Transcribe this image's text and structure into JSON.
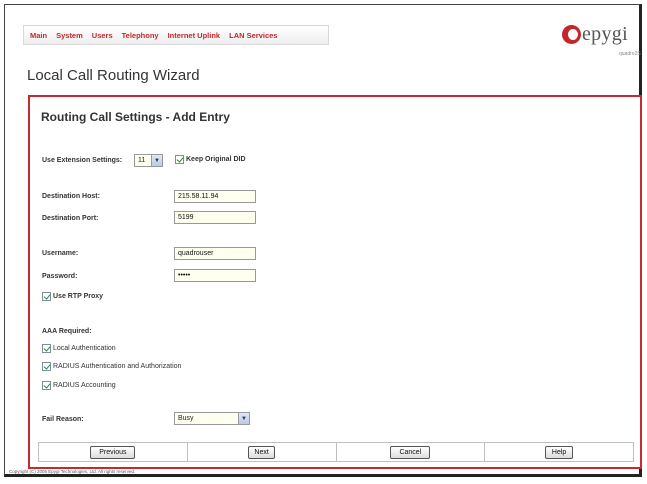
{
  "nav": {
    "items": [
      "Main",
      "System",
      "Users",
      "Telephony",
      "Internet Uplink",
      "LAN Services"
    ]
  },
  "brand": {
    "logo_text": "epygi",
    "model": "quadro2S"
  },
  "page": {
    "title": "Local Call Routing Wizard"
  },
  "panel": {
    "title": "Routing Call Settings - Add Entry",
    "use_extension_settings": {
      "label": "Use Extension Settings:",
      "value": "11"
    },
    "keep_original_did": {
      "label": "Keep Original DID",
      "checked": true
    },
    "destination_host": {
      "label": "Destination Host:",
      "value": "215.58.11.94"
    },
    "destination_port": {
      "label": "Destination Port:",
      "value": "5199"
    },
    "username": {
      "label": "Username:",
      "value": "quadrouser"
    },
    "password": {
      "label": "Password:",
      "value": "•••••"
    },
    "use_rtp_proxy": {
      "label": "Use RTP Proxy",
      "checked": true
    },
    "aaa_required": {
      "label": "AAA Required:",
      "local_auth": "Local Authentication",
      "radius_auth": "RADIUS Authentication and Authorization",
      "radius_accounting": "RADIUS Accounting"
    },
    "fail_reason": {
      "label": "Fail Reason:",
      "value": "Busy"
    }
  },
  "buttons": {
    "previous": "Previous",
    "next": "Next",
    "cancel": "Cancel",
    "help": "Help"
  },
  "footer": {
    "copyright": "Copyright (C) 2005 Epygi Technologies, Ltd. All rights reserved."
  },
  "colors": {
    "accent": "#c42a30",
    "nav_text": "#c0282e"
  }
}
